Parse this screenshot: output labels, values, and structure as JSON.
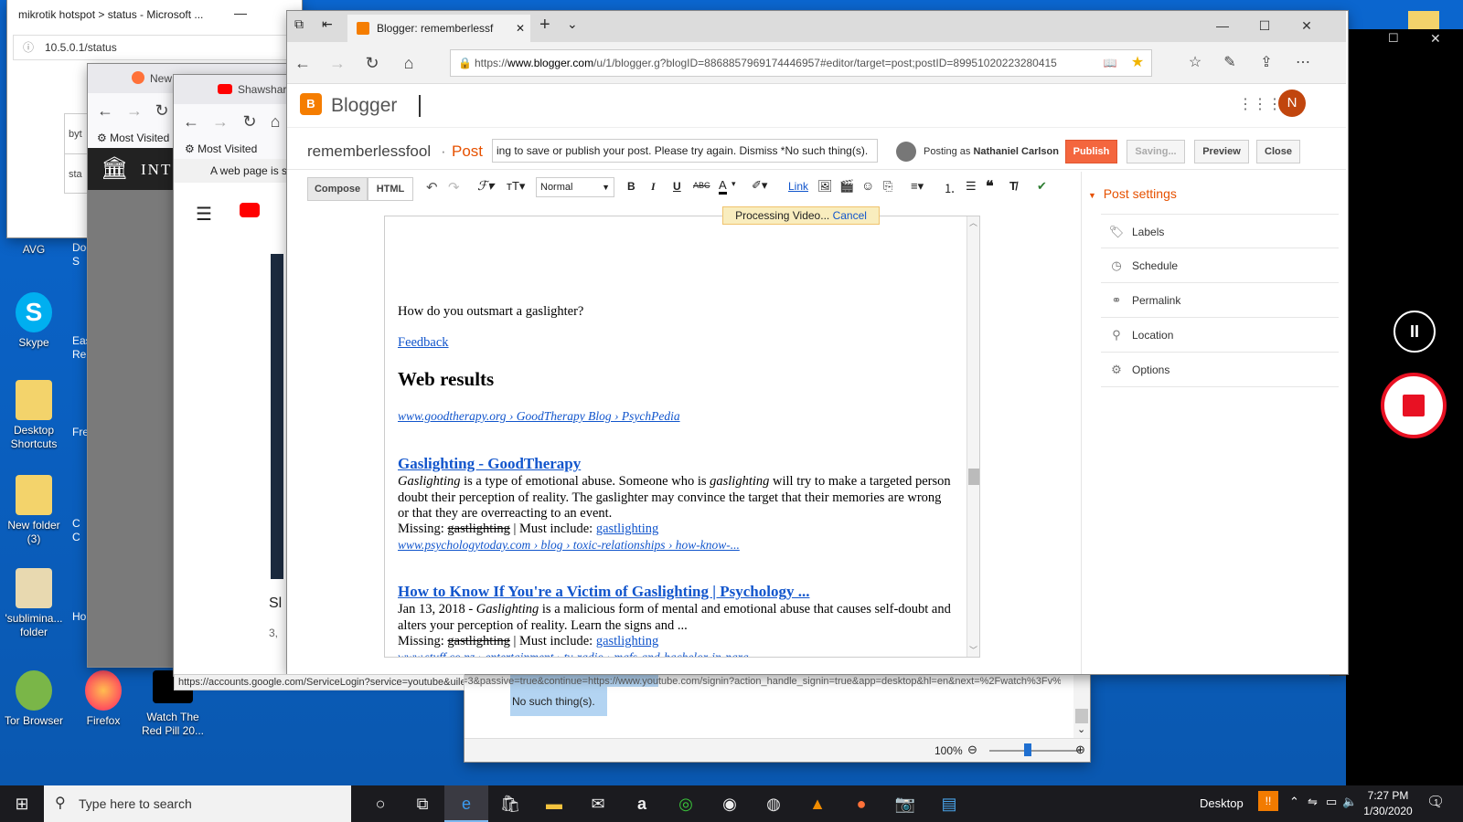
{
  "desktop": {
    "icons": [
      {
        "label": "AVG"
      },
      {
        "label": "Skype"
      },
      {
        "label": "Desktop Shortcuts"
      },
      {
        "label": "New folder (3)"
      },
      {
        "label": "'sublimina... folder"
      },
      {
        "label": "Tor Browser"
      },
      {
        "label": "Firefox"
      },
      {
        "label": "Watch The Red Pill 20..."
      }
    ],
    "partial_labels": [
      "Doc S",
      "Eas Re",
      "Fre",
      "C C",
      "Ho"
    ]
  },
  "hotspot": {
    "title": "mikrotik hotspot > status - Microsoft ...",
    "url": "10.5.0.1/status",
    "cells": [
      "byt",
      "sta"
    ]
  },
  "ff1": {
    "tab": "New",
    "bookmark": "Most Visited",
    "site": "INT"
  },
  "ff2": {
    "tab": "Shawshar",
    "bookmark": "Most Visited",
    "notice": "A web page is s",
    "video_title": "Sl",
    "video_meta": "3,",
    "status_url": "https://accounts.google.com/ServiceLogin?service=youtube&uilel=3&passive=true&continue=https://www.youtube.com/signin?action_handle_signin=true&app=desktop&hl=en&next=%2Fwatch%3Fv%3D6jKRZPGa5rc&hl=en&ec=65620"
  },
  "word": {
    "selected": "No such thing(s).",
    "zoom": "100%"
  },
  "edge": {
    "tab_title": "Blogger: rememberlessf",
    "url_prefix": "https://",
    "url_host": "www.blogger.com",
    "url_rest": "/u/1/blogger.g?blogID=8868857969174446957#editor/target=post;postID=89951020223280415"
  },
  "blogger": {
    "brand": "Blogger",
    "avatar": "N",
    "blog_name": "rememberlessfool",
    "dot": " · ",
    "post_label": "Post",
    "error_msg": "ing to save or publish your post. Please try again. Dismiss *No such thing(s).",
    "posting_as": "Posting as",
    "author": "Nathaniel Carlson",
    "buttons": {
      "publish": "Publish",
      "saving": "Saving...",
      "preview": "Preview",
      "close": "Close"
    },
    "modes": {
      "compose": "Compose",
      "html": "HTML"
    },
    "font_size": "Normal",
    "link": "Link",
    "processing": "Processing Video...",
    "cancel": "Cancel",
    "post_settings": "Post settings",
    "settings": [
      "Labels",
      "Schedule",
      "Permalink",
      "Location",
      "Options"
    ]
  },
  "content": {
    "question": "How do you outsmart a gaslighter?",
    "feedback": "Feedback",
    "heading": "Web results",
    "cite1": "www.goodtherapy.org › GoodTherapy Blog › PsychPedia",
    "r1_title": "Gaslighting - GoodTherapy",
    "r1_a": "Gaslighting",
    "r1_b": " is a type of emotional abuse. Someone who is ",
    "r1_c": "gaslighting",
    "r1_d": " will try to make a targeted person doubt their perception of reality. The gaslighter may convince the target that their memories are wrong or that they are overreacting to an event.",
    "missing": "Missing: ",
    "strike": "gastlighting",
    "must": " | Must include: ",
    "must_link": "gastlighting",
    "cite2": "www.psychologytoday.com › blog › toxic-relationships › how-know-...",
    "r2_title": "How to Know If You're a Victim of Gaslighting | Psychology ...",
    "r2_a": "Jan 13, 2018 - ",
    "r2_b": "Gaslighting",
    "r2_c": " is a malicious form of mental and emotional abuse that causes self-doubt and alters your perception of reality. Learn the signs and ...",
    "cite3": "www.stuff.co.nz › entertainment › tv-radio › mafs-and-bachelor-in-para..."
  },
  "taskbar": {
    "search": "Type here to search",
    "desktop": "Desktop",
    "time": "7:27 PM",
    "date": "1/30/2020",
    "notif": "1"
  }
}
